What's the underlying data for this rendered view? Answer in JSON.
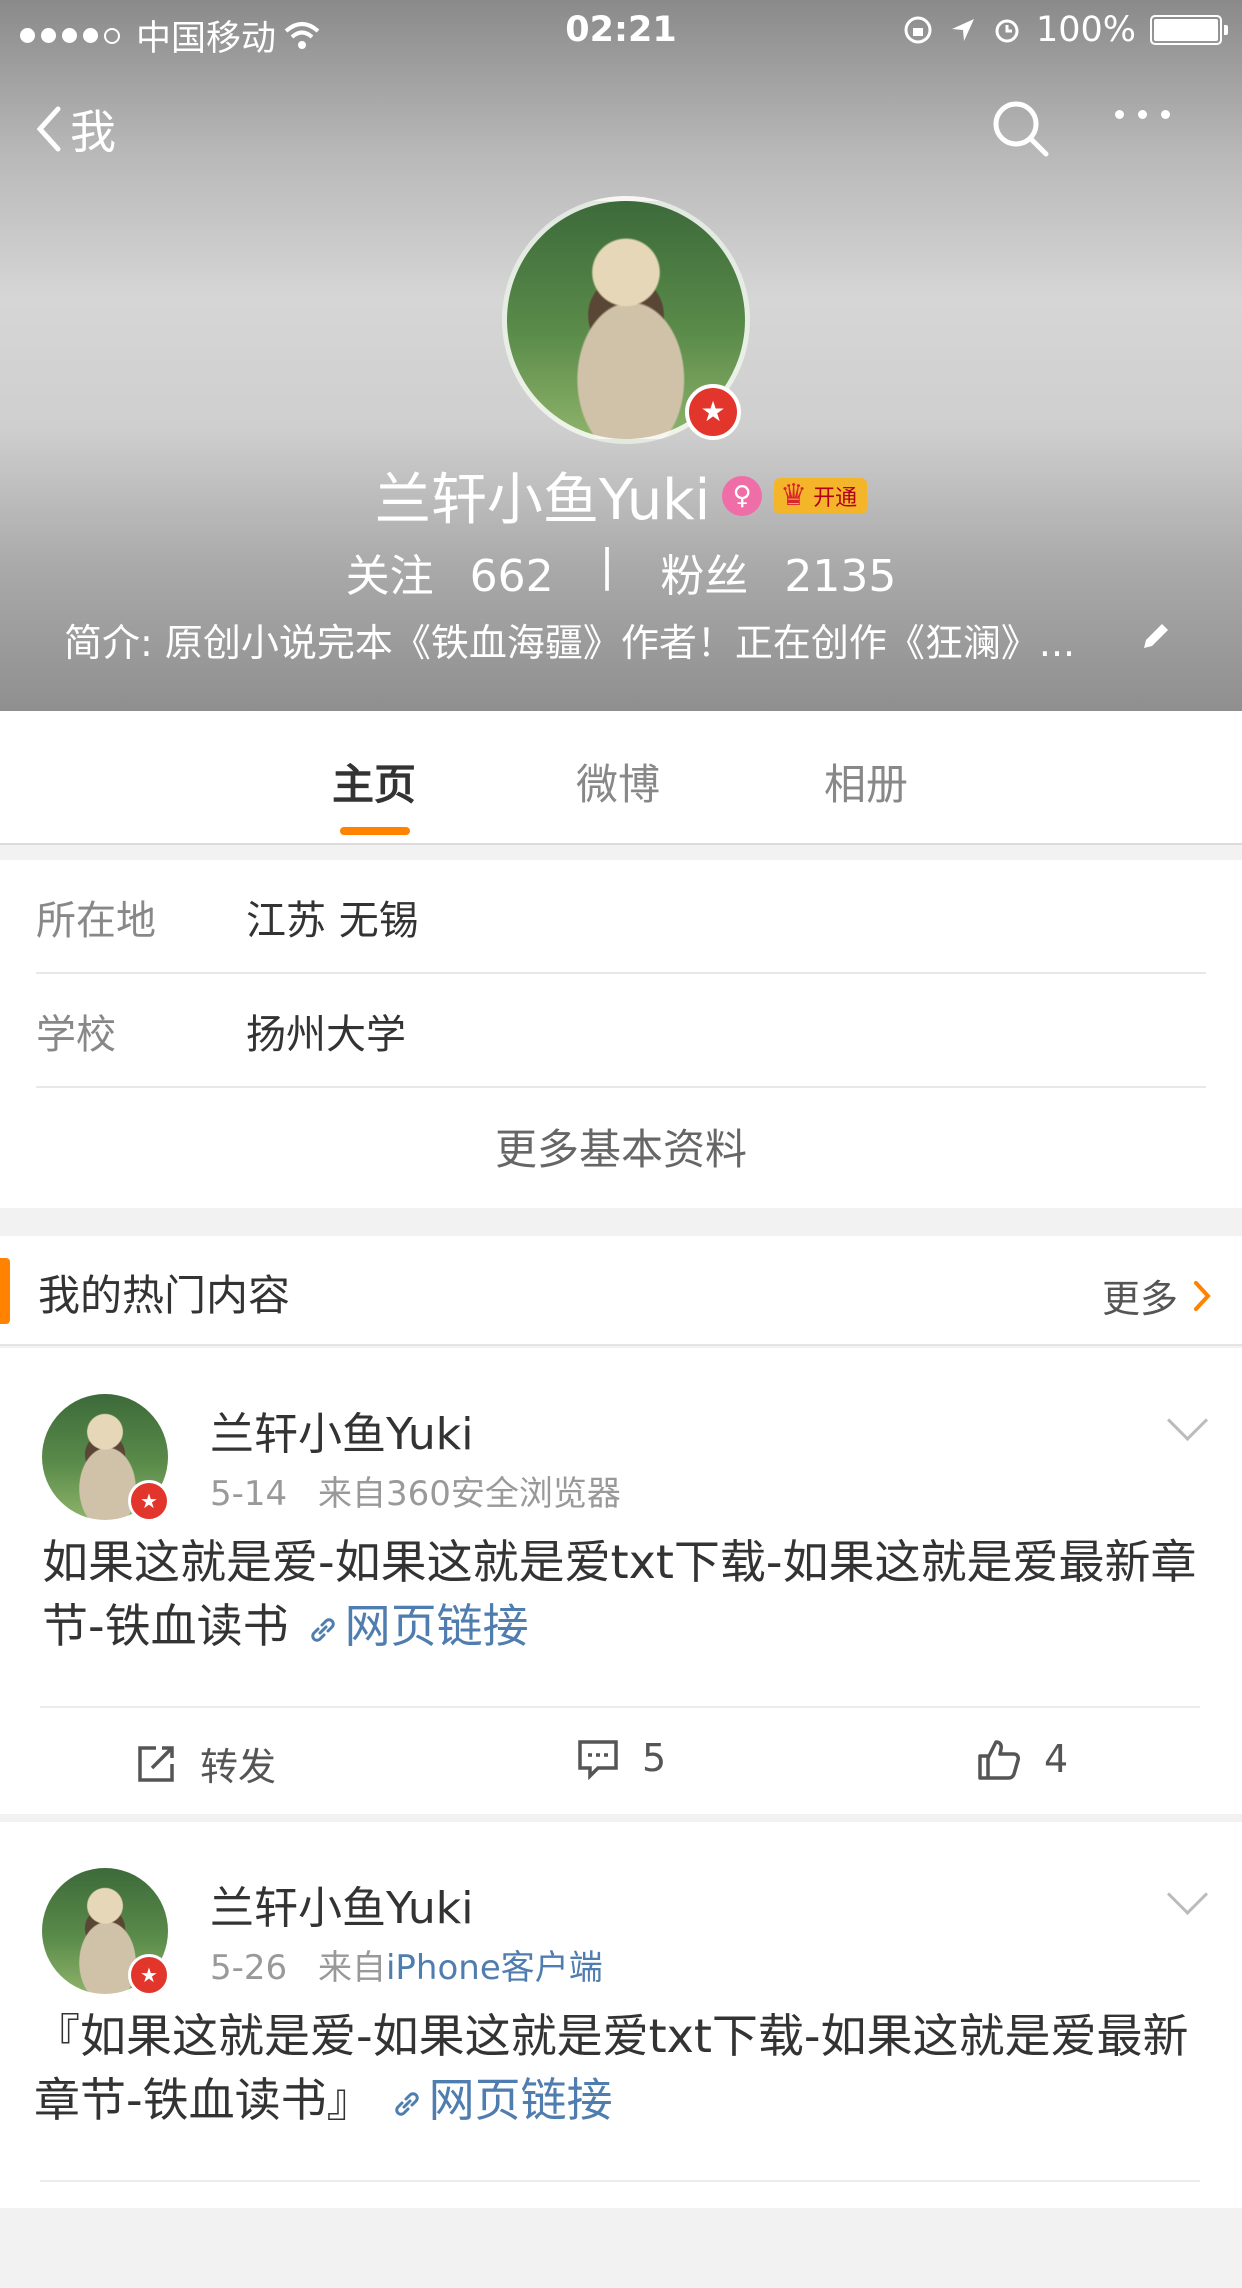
{
  "status_bar": {
    "carrier": "中国移动",
    "time": "02:21",
    "battery": "100%"
  },
  "nav": {
    "back_label": "我"
  },
  "profile": {
    "name": "兰轩小鱼Yuki",
    "vip_label": "开通",
    "following_label": "关注",
    "following_count": "662",
    "followers_label": "粉丝",
    "followers_count": "2135",
    "bio": "简介: 原创小说完本《铁血海疆》作者！正在创作《狂澜》..."
  },
  "tabs": [
    "主页",
    "微博",
    "相册"
  ],
  "info": {
    "rows": [
      {
        "key": "所在地",
        "value": "江苏 无锡"
      },
      {
        "key": "学校",
        "value": "扬州大学"
      }
    ],
    "more": "更多基本资料"
  },
  "hot_section": {
    "title": "我的热门内容",
    "more": "更多"
  },
  "posts": [
    {
      "author": "兰轩小鱼Yuki",
      "date": "5-14",
      "from_prefix": "来自",
      "source": "360安全浏览器",
      "text": "如果这就是爱-如果这就是爱txt下载-如果这就是爱最新章节-铁血读书",
      "link_label": "网页链接",
      "repost_label": "转发",
      "comments": "5",
      "likes": "4"
    },
    {
      "author": "兰轩小鱼Yuki",
      "date": "5-26",
      "from_prefix": "来自",
      "source": "iPhone客户端",
      "text": "『如果这就是爱-如果这就是爱txt下载-如果这就是爱最新章节-铁血读书』",
      "link_label": "网页链接"
    }
  ],
  "colors": {
    "accent": "#ff8200",
    "link": "#507daf",
    "verified_badge": "#e2352b"
  }
}
